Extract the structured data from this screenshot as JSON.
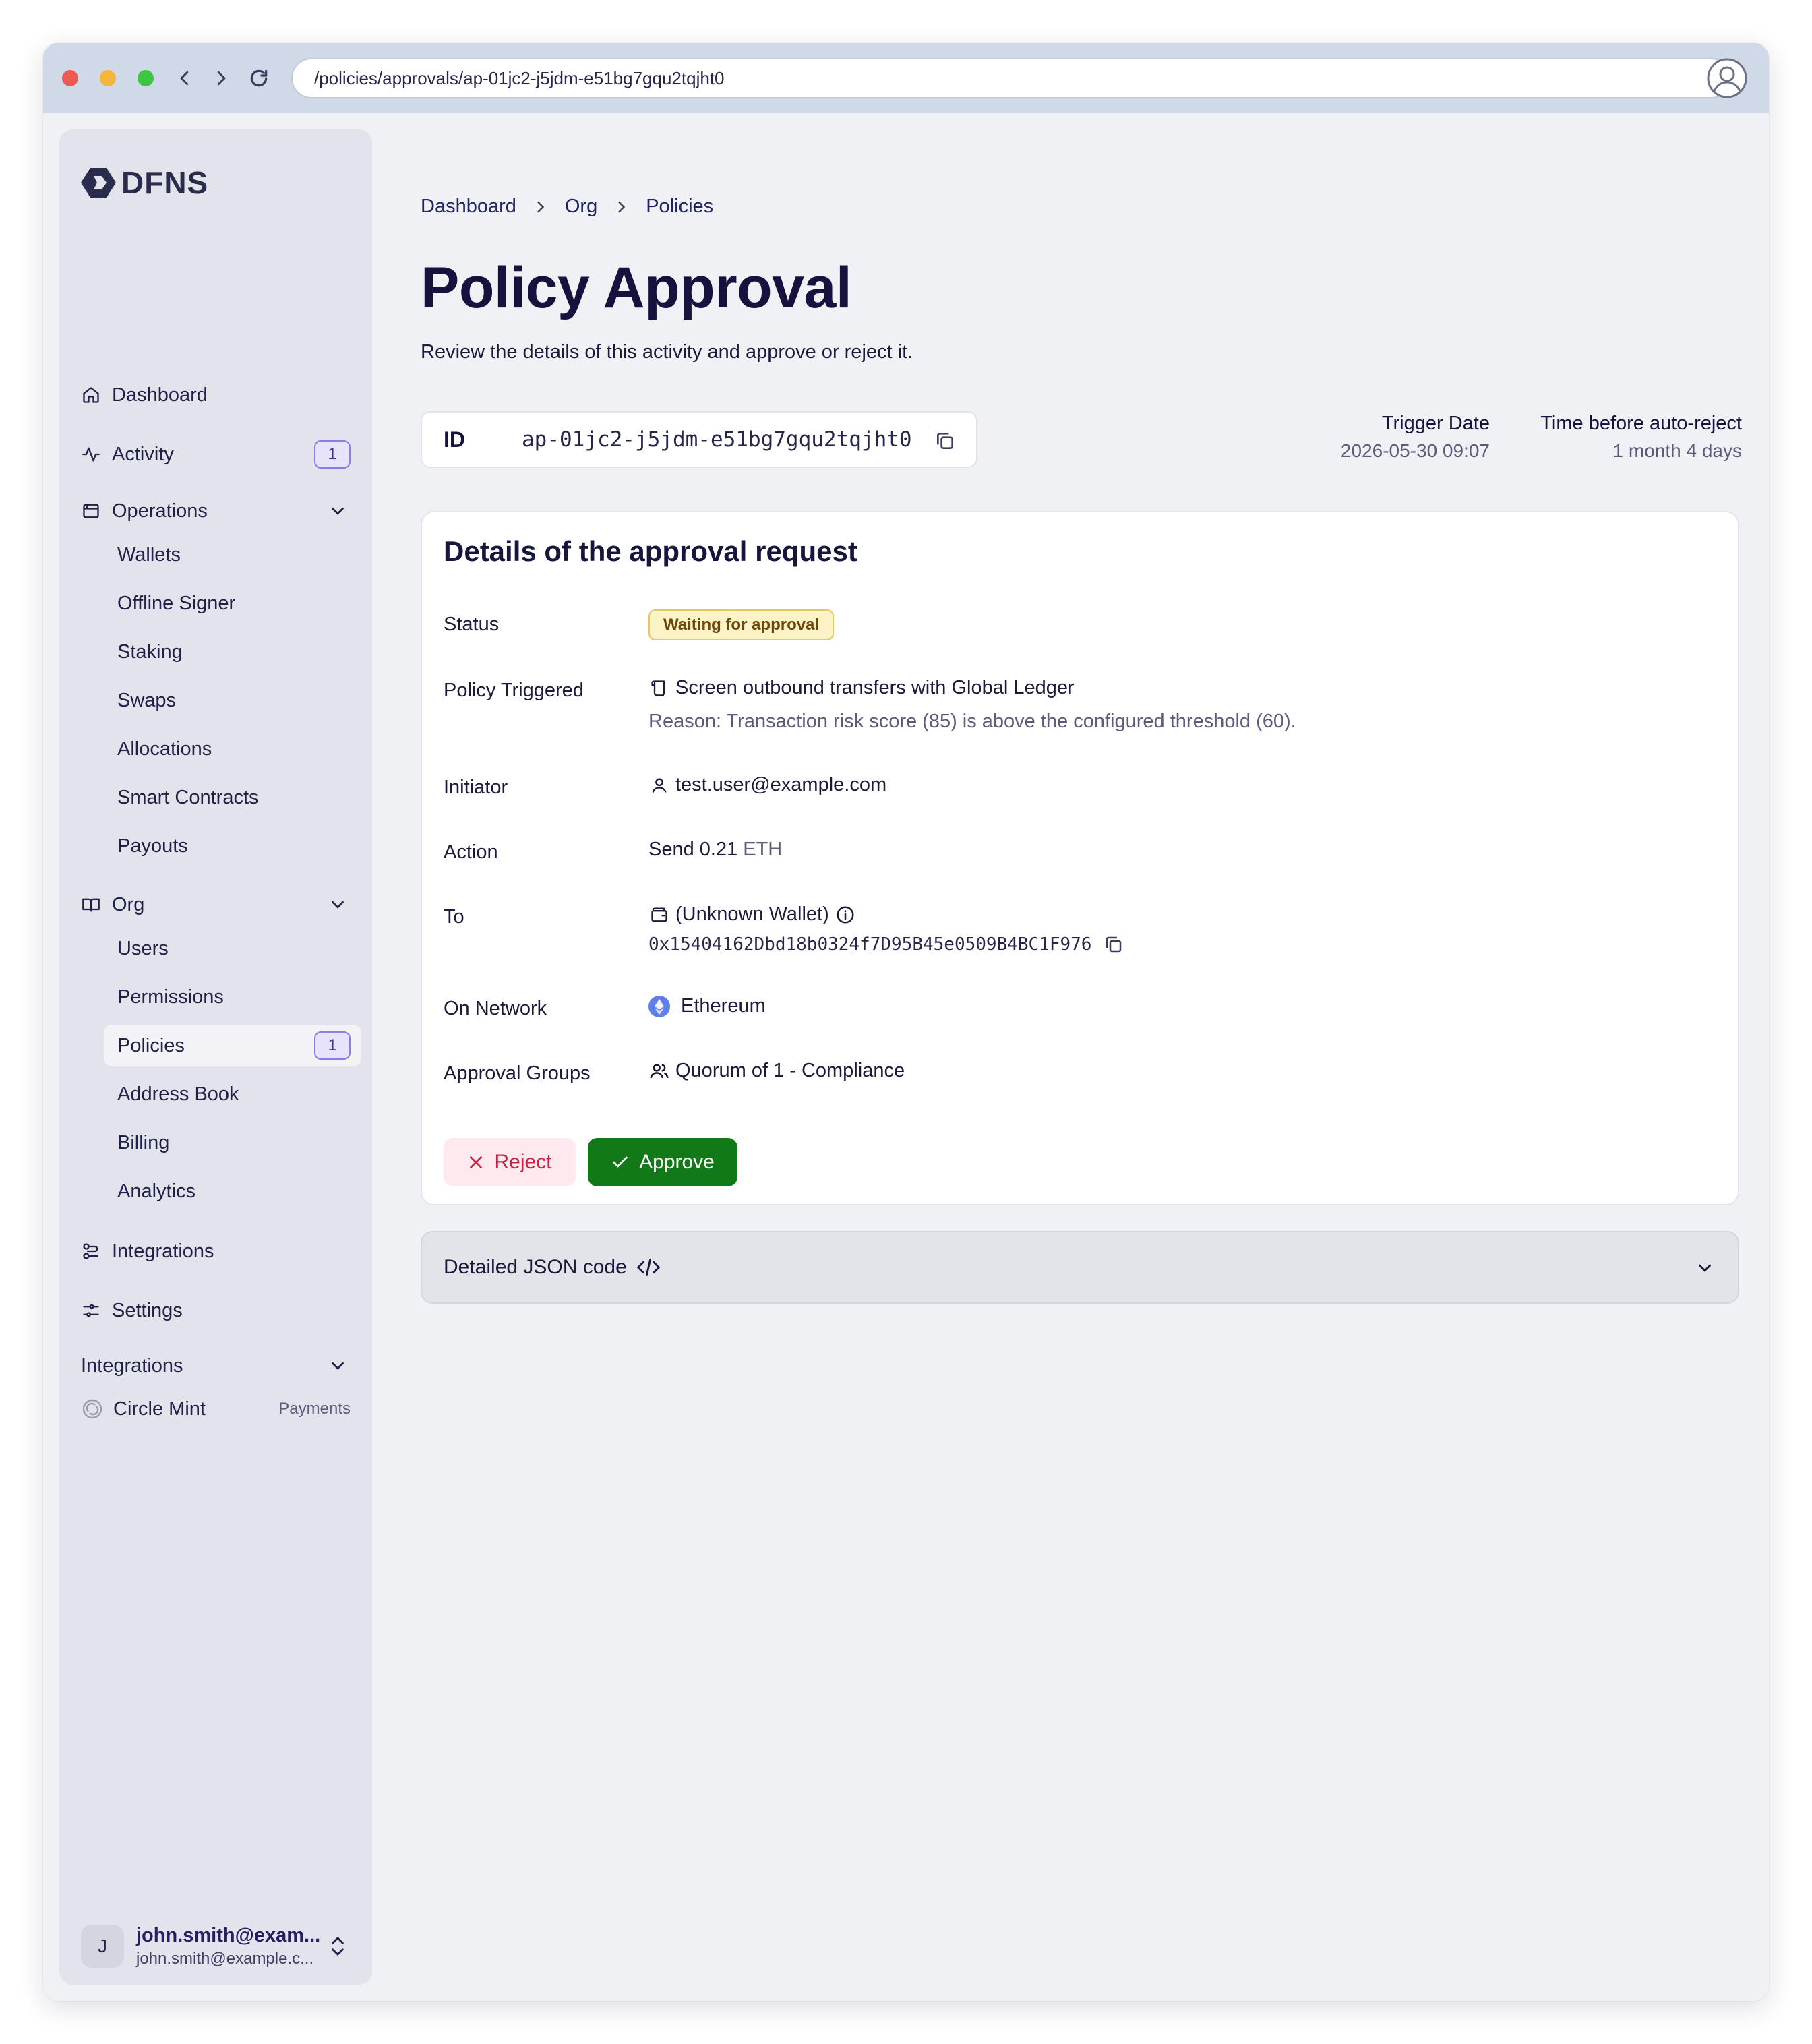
{
  "browser": {
    "url": "/policies/approvals/ap-01jc2-j5jdm-e51bg7gqu2tqjht0"
  },
  "sidebar": {
    "logo": "DFNS",
    "dashboard": "Dashboard",
    "activity": "Activity",
    "activity_badge": "1",
    "operations": "Operations",
    "operations_items": [
      "Wallets",
      "Offline Signer",
      "Staking",
      "Swaps",
      "Allocations",
      "Smart Contracts",
      "Payouts"
    ],
    "org": "Org",
    "org_items": [
      "Users",
      "Permissions",
      "Policies",
      "Address Book",
      "Billing",
      "Analytics"
    ],
    "policies_badge": "1",
    "integrations": "Integrations",
    "settings": "Settings",
    "integrations_section": "Integrations",
    "circle_mint": "Circle Mint",
    "circle_mint_tag": "Payments",
    "user_initial": "J",
    "user_name": "john.smith@exam...",
    "user_email": "john.smith@example.c..."
  },
  "breadcrumb": [
    "Dashboard",
    "Org",
    "Policies"
  ],
  "page": {
    "title": "Policy Approval",
    "subtitle": "Review the details of this activity and approve or reject it.",
    "id_label": "ID",
    "id_value": "ap-01jc2-j5jdm-e51bg7gqu2tqjht0",
    "trigger_date_label": "Trigger Date",
    "trigger_date_value": "2026-05-30 09:07",
    "auto_reject_label": "Time before auto-reject",
    "auto_reject_value": "1 month 4 days"
  },
  "details": {
    "title": "Details of the approval request",
    "status_label": "Status",
    "status_value": "Waiting for approval",
    "policy_label": "Policy Triggered",
    "policy_value": "Screen outbound transfers with Global Ledger",
    "policy_reason": "Reason: Transaction risk score (85) is above the configured threshold (60).",
    "initiator_label": "Initiator",
    "initiator_value": "test.user@example.com",
    "action_label": "Action",
    "action_value": "Send 0.21",
    "action_unit": "ETH",
    "to_label": "To",
    "to_wallet": "(Unknown Wallet)",
    "to_address": "0x15404162Dbd18b0324f7D95B45e0509B4BC1F976",
    "network_label": "On Network",
    "network_value": "Ethereum",
    "groups_label": "Approval Groups",
    "groups_value": "Quorum of 1 - Compliance",
    "reject_label": "Reject",
    "approve_label": "Approve"
  },
  "json_section": {
    "label": "Detailed JSON code"
  },
  "colors": {
    "approve": "#117a17",
    "reject_bg": "#fde9ee",
    "reject_text": "#c42445",
    "badge_border": "#8a7fe0",
    "status_bg": "#fdf3c7"
  }
}
